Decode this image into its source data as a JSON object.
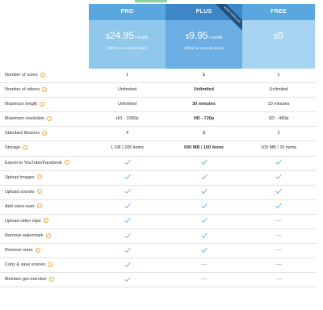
{
  "plans": {
    "pro": {
      "name": "PRO",
      "currency": "$",
      "amount": "24.95",
      "period": "/ month",
      "billing": "(billed on a yearly basis)"
    },
    "plus": {
      "name": "PLUS",
      "currency": "$",
      "amount": "9.95",
      "period": "/ month",
      "billing": "(billed on a yearly basis)",
      "ribbon": "MOST POPULAR"
    },
    "free": {
      "name": "FREE",
      "currency": "$",
      "amount": "0"
    }
  },
  "help_glyph": "?",
  "features": [
    {
      "label": "Number of users",
      "pro": "1",
      "plus": "1",
      "free": "1"
    },
    {
      "label": "Number of videos",
      "pro": "Unlimited",
      "plus": "Unlimited",
      "free": "Unlimited"
    },
    {
      "label": "Maximum length",
      "pro": "Unlimited",
      "plus": "30 minutes",
      "free": "10 minutes"
    },
    {
      "label": "Maximum resolution",
      "pro": "HD - 1080p",
      "plus": "HD - 720p",
      "free": "SD - 480p"
    },
    {
      "label": "Standard libraries",
      "pro": "4",
      "plus": "3",
      "free": "2"
    },
    {
      "label": "Storage",
      "pro": "1 GB / 200 items",
      "plus": "500 MB / 100 items",
      "free": "100 MB / 20 items"
    },
    {
      "label": "Export to YouTube/Facebook",
      "pro": "check",
      "plus": "check",
      "free": "check"
    },
    {
      "label": "Upload images",
      "pro": "check",
      "plus": "check",
      "free": "check"
    },
    {
      "label": "Upload sounds",
      "pro": "check",
      "plus": "check",
      "free": "check"
    },
    {
      "label": "Add voice-over",
      "pro": "check",
      "plus": "check",
      "free": "check"
    },
    {
      "label": "Upload video clips",
      "pro": "check",
      "plus": "check",
      "free": "dash"
    },
    {
      "label": "Remove watermark",
      "pro": "check",
      "plus": "check",
      "free": "dash"
    },
    {
      "label": "Remove outro",
      "pro": "check",
      "plus": "check",
      "free": "dash"
    },
    {
      "label": "Copy & save scenes",
      "pro": "check",
      "plus": "dash",
      "free": "dash"
    },
    {
      "label": "Member-get-member",
      "pro": "check",
      "plus": "dash",
      "free": "dash"
    }
  ],
  "colors": {
    "check": "#4a90d9",
    "help": "#f0a53a"
  }
}
